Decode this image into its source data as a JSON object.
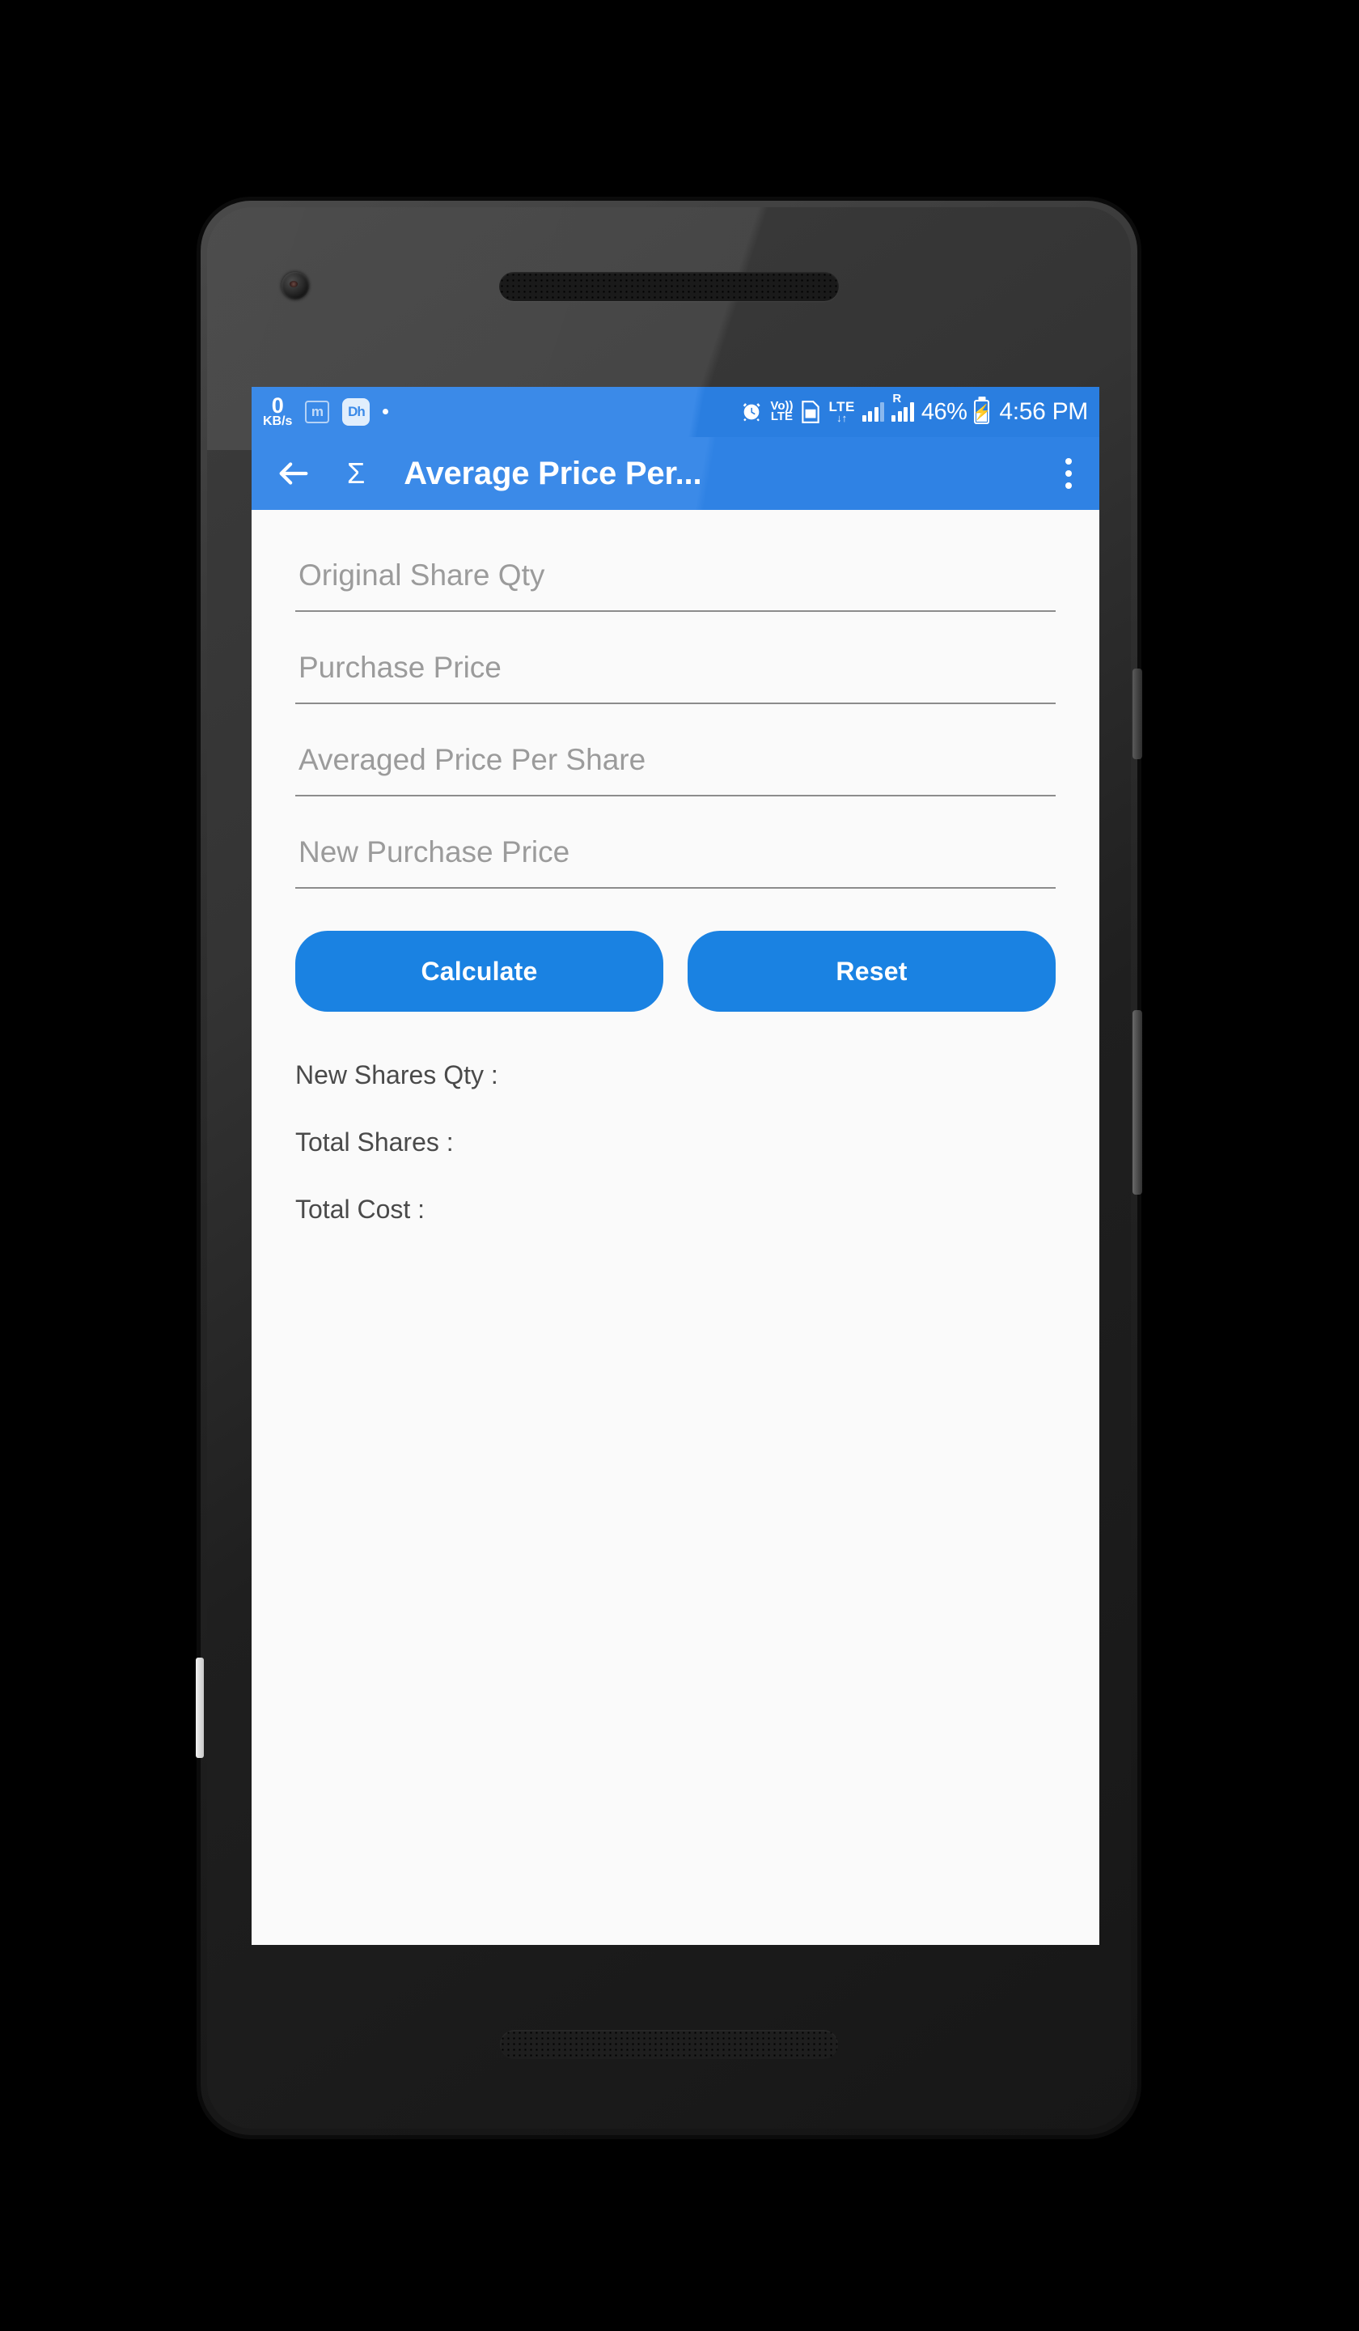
{
  "status_bar": {
    "data_rate_value": "0",
    "data_rate_unit": "KB/s",
    "app_icon_m": "m",
    "app_icon_dh": "Dh",
    "alarm_icon": "alarm-icon",
    "volte_top": "Vo))",
    "volte_bottom": "LTE",
    "sim_icon": "sim-card-icon",
    "network_type": "LTE",
    "data_arrows": "↓↑",
    "roaming_label": "R",
    "battery_percent": "46%",
    "battery_icon": "battery-charging-icon",
    "time": "4:56 PM"
  },
  "app_bar": {
    "back_icon": "back-arrow-icon",
    "brand_icon": "sigma-icon",
    "brand_glyph": "Σ",
    "title": "Average Price Per...",
    "overflow_icon": "overflow-menu-icon"
  },
  "form": {
    "fields": [
      {
        "name": "original-share-qty",
        "placeholder": "Original Share Qty",
        "value": ""
      },
      {
        "name": "purchase-price",
        "placeholder": "Purchase Price",
        "value": ""
      },
      {
        "name": "averaged-price-per-share",
        "placeholder": "Averaged Price Per Share",
        "value": ""
      },
      {
        "name": "new-purchase-price",
        "placeholder": "New Purchase Price",
        "value": ""
      }
    ],
    "calculate_label": "Calculate",
    "reset_label": "Reset"
  },
  "results": [
    {
      "label": "New Shares Qty :",
      "value": ""
    },
    {
      "label": "Total Shares :",
      "value": ""
    },
    {
      "label": "Total Cost :",
      "value": ""
    }
  ],
  "colors": {
    "status_bar_blue": "#2a7ee0",
    "app_bar_blue": "#3b8ae8",
    "button_blue": "#1a82e2",
    "screen_background": "#fafafa",
    "placeholder_grey": "#9b9b9b",
    "underline_grey": "#8c8c8c",
    "result_text_grey": "#4a4a4a"
  }
}
